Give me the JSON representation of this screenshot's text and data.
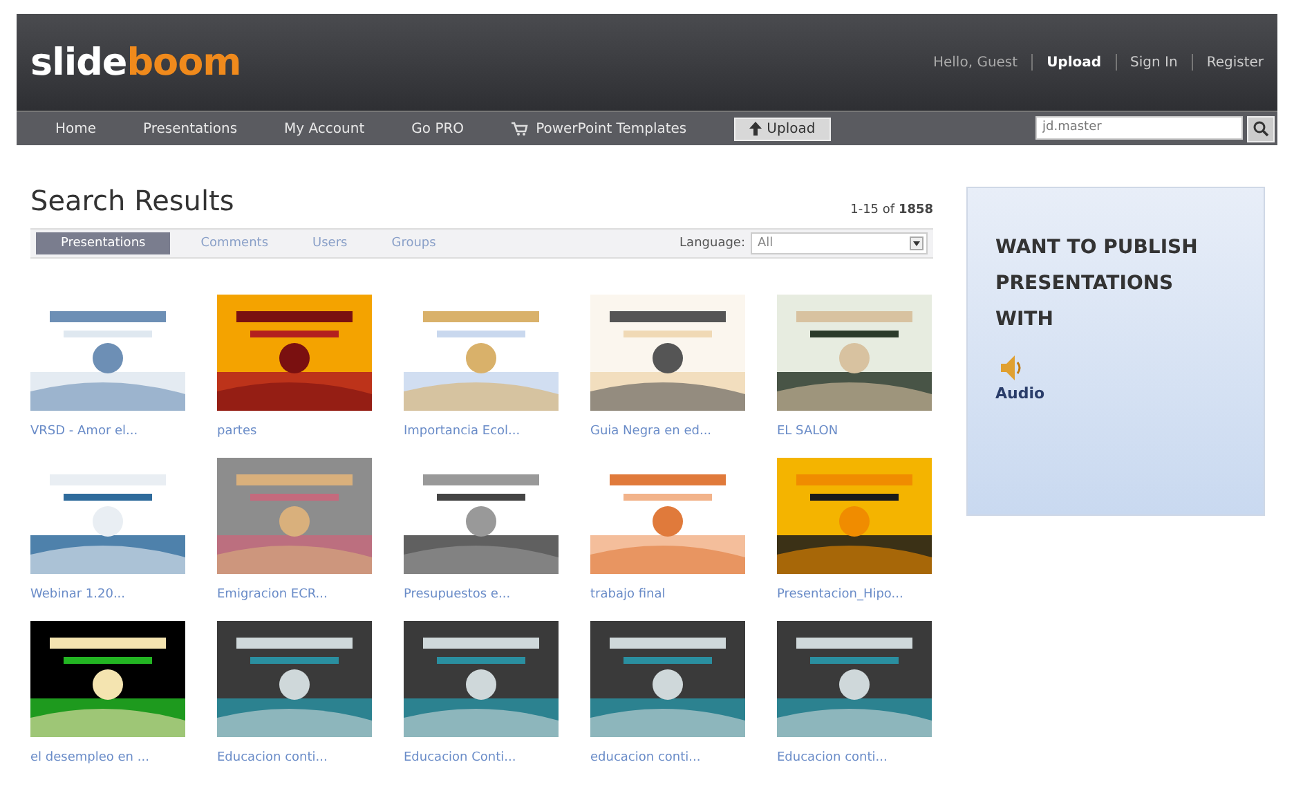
{
  "logo": {
    "part_1": "slide",
    "part_2": "boom"
  },
  "user_links": [
    {
      "label": "Hello, Guest",
      "kind": "text"
    },
    {
      "label": "Upload",
      "kind": "bold"
    },
    {
      "label": "Sign In",
      "kind": "link"
    },
    {
      "label": "Register",
      "kind": "link"
    }
  ],
  "nav": [
    {
      "label": "Home",
      "kind": "link"
    },
    {
      "label": "Presentations",
      "kind": "link"
    },
    {
      "label": "My Account",
      "kind": "link"
    },
    {
      "label": "Go PRO",
      "kind": "link"
    },
    {
      "label": "PowerPoint Templates",
      "kind": "cart"
    },
    {
      "label": "Upload",
      "kind": "upload"
    }
  ],
  "search": {
    "value": "jd.master"
  },
  "results": {
    "title": "Search Results",
    "count_prefix": "1-15 of ",
    "count": "1858",
    "tabs": [
      {
        "label": "Presentations",
        "selected": true
      },
      {
        "label": "Comments",
        "selected": false
      },
      {
        "label": "Users",
        "selected": false
      },
      {
        "label": "Groups",
        "selected": false
      }
    ],
    "language": {
      "label": "Language:",
      "value": "All"
    },
    "items": [
      {
        "title": "VRSD - Amor el..."
      },
      {
        "title": "partes"
      },
      {
        "title": "Importancia Ecol..."
      },
      {
        "title": "Guia Negra en ed..."
      },
      {
        "title": "EL SALON"
      },
      {
        "title": "Webinar 1.20..."
      },
      {
        "title": "Emigracion ECR..."
      },
      {
        "title": "Presupuestos e..."
      },
      {
        "title": "trabajo final"
      },
      {
        "title": "Presentacion_Hipo..."
      },
      {
        "title": "el desempleo en ..."
      },
      {
        "title": "Educacion conti..."
      },
      {
        "title": "Educacion Conti..."
      },
      {
        "title": "educacion conti..."
      },
      {
        "title": "Educacion conti..."
      }
    ]
  },
  "promo": {
    "heading": "WANT TO PUBLISH PRESENTATIONS WITH",
    "feature": "Audio"
  }
}
